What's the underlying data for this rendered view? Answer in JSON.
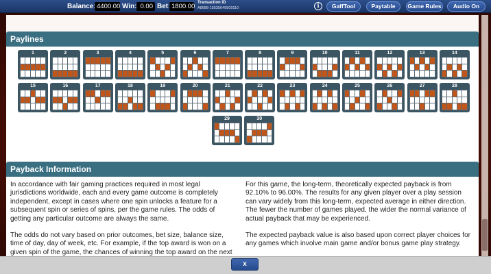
{
  "topbar": {
    "balance_label": "Balance:",
    "balance_value": "4400.00",
    "win_label": "Win:",
    "win_value": "0.00",
    "bet_label": "Bet:",
    "bet_value": "1800.00",
    "transaction_label": "Transaction ID",
    "transaction_value": "A8688-15535649509110",
    "info_icon": "i",
    "buttons": [
      "GaffTool",
      "Paytable",
      "Game Rules",
      "Audio On"
    ]
  },
  "paylines": {
    "title": "Paylines",
    "lines": [
      {
        "num": "1",
        "rows": [
          1,
          1,
          1,
          1,
          1
        ]
      },
      {
        "num": "2",
        "rows": [
          2,
          2,
          2,
          2,
          2
        ]
      },
      {
        "num": "3",
        "rows": [
          0,
          0,
          0,
          0,
          0
        ]
      },
      {
        "num": "4",
        "rows": [
          2,
          2,
          2,
          2,
          2
        ]
      },
      {
        "num": "5",
        "rows": [
          0,
          1,
          2,
          1,
          0
        ]
      },
      {
        "num": "6",
        "rows": [
          2,
          1,
          0,
          1,
          2
        ]
      },
      {
        "num": "7",
        "rows": [
          0,
          0,
          0,
          0,
          0
        ]
      },
      {
        "num": "8",
        "rows": [
          2,
          2,
          2,
          2,
          2
        ]
      },
      {
        "num": "9",
        "rows": [
          1,
          0,
          0,
          0,
          1
        ]
      },
      {
        "num": "10",
        "rows": [
          1,
          2,
          2,
          2,
          1
        ]
      },
      {
        "num": "11",
        "rows": [
          1,
          0,
          1,
          0,
          1
        ]
      },
      {
        "num": "12",
        "rows": [
          1,
          2,
          1,
          2,
          1
        ]
      },
      {
        "num": "13",
        "rows": [
          0,
          1,
          0,
          1,
          0
        ]
      },
      {
        "num": "14",
        "rows": [
          2,
          1,
          2,
          1,
          2
        ]
      },
      {
        "num": "15",
        "rows": [
          1,
          1,
          0,
          1,
          1
        ]
      },
      {
        "num": "16",
        "rows": [
          1,
          1,
          2,
          1,
          1
        ]
      },
      {
        "num": "17",
        "rows": [
          0,
          0,
          1,
          0,
          0
        ]
      },
      {
        "num": "18",
        "rows": [
          2,
          2,
          1,
          2,
          2
        ]
      },
      {
        "num": "19",
        "rows": [
          0,
          2,
          2,
          2,
          0
        ]
      },
      {
        "num": "20",
        "rows": [
          2,
          0,
          0,
          0,
          2
        ]
      },
      {
        "num": "21",
        "rows": [
          1,
          2,
          0,
          2,
          1
        ]
      },
      {
        "num": "22",
        "rows": [
          1,
          0,
          2,
          0,
          1
        ]
      },
      {
        "num": "23",
        "rows": [
          0,
          2,
          0,
          2,
          0
        ]
      },
      {
        "num": "24",
        "rows": [
          2,
          0,
          2,
          0,
          2
        ]
      },
      {
        "num": "25",
        "rows": [
          0,
          2,
          1,
          0,
          2
        ]
      },
      {
        "num": "26",
        "rows": [
          2,
          0,
          1,
          2,
          0
        ]
      },
      {
        "num": "27",
        "rows": [
          0,
          0,
          2,
          0,
          0
        ]
      },
      {
        "num": "28",
        "rows": [
          2,
          2,
          0,
          2,
          2
        ]
      },
      {
        "num": "29",
        "rows": [
          0,
          1,
          1,
          1,
          2
        ]
      },
      {
        "num": "30",
        "rows": [
          2,
          1,
          1,
          1,
          0
        ]
      }
    ]
  },
  "payback": {
    "title": "Payback Information",
    "left": [
      "In accordance with fair gaming practices required in most legal jurisdictions worldwide, each and every game outcome is completely independent, except in cases where one spin unlocks a feature for a subsequent spin or series of spins, per the game rules. The odds of getting any particular outcome are always the same.",
      "The odds do not vary based on prior outcomes, bet size, balance size, time of day, day of week, etc. For example, if the top award is won on a given spin of the game, the chances of winning the top award on the next spin are exactly the same."
    ],
    "right": [
      "For this game, the long-term, theoretically expected payback is from 92.10% to 96.00%. The results for any given player over a play session can vary widely from this long-term, expected average in either direction. The fewer the number of games played, the wider the normal variance of actual payback that may be experienced.",
      "The expected payback value is also based upon correct player choices for any games which involve main game and/or bonus game play strategy."
    ]
  },
  "close_label": "x"
}
